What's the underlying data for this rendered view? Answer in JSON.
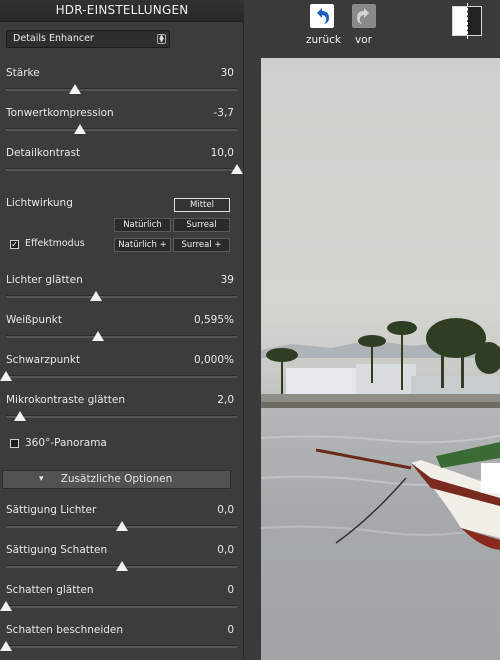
{
  "panel": {
    "title": "HDR-EINSTELLUNGEN",
    "preset": "Details Enhancer"
  },
  "sliders": [
    {
      "label": "Stärke",
      "value": "30",
      "level": 0.3
    },
    {
      "label": "Tonwertkompression",
      "value": "-3,7",
      "level": 0.32
    },
    {
      "label": "Detailkontrast",
      "value": "10,0",
      "level": 1.0
    },
    {
      "label": "Lichter glätten",
      "value": "39",
      "level": 0.39
    },
    {
      "label": "Weißpunkt",
      "value": "0,595%",
      "level": 0.4
    },
    {
      "label": "Schwarzpunkt",
      "value": "0,000%",
      "level": 0.0
    },
    {
      "label": "Mikrokontraste glätten",
      "value": "2,0",
      "level": 0.06
    },
    {
      "label": "Sättigung Lichter",
      "value": "0,0",
      "level": 0.5
    },
    {
      "label": "Sättigung Schatten",
      "value": "0,0",
      "level": 0.5
    },
    {
      "label": "Schatten glätten",
      "value": "0",
      "level": 0.0
    },
    {
      "label": "Schatten beschneiden",
      "value": "0",
      "level": 0.0
    }
  ],
  "light": {
    "label": "Lichtwirkung",
    "buttons": [
      "Mittel",
      "Natürlich",
      "Surreal",
      "Natürlich +",
      "Surreal +"
    ],
    "selected": "Mittel",
    "effect_mode_label": "Effektmodus",
    "effect_mode_checked": true
  },
  "panorama": {
    "label": "360°-Panorama",
    "checked": false
  },
  "extra_options": "Zusätzliche Optionen",
  "toolbar": {
    "undo_label": "zurück",
    "redo_label": "vor"
  },
  "colors": {
    "undo_icon": "#ffffff",
    "redo_icon": "#8a8a8a",
    "arrow_blue": "#1f5fbf"
  }
}
